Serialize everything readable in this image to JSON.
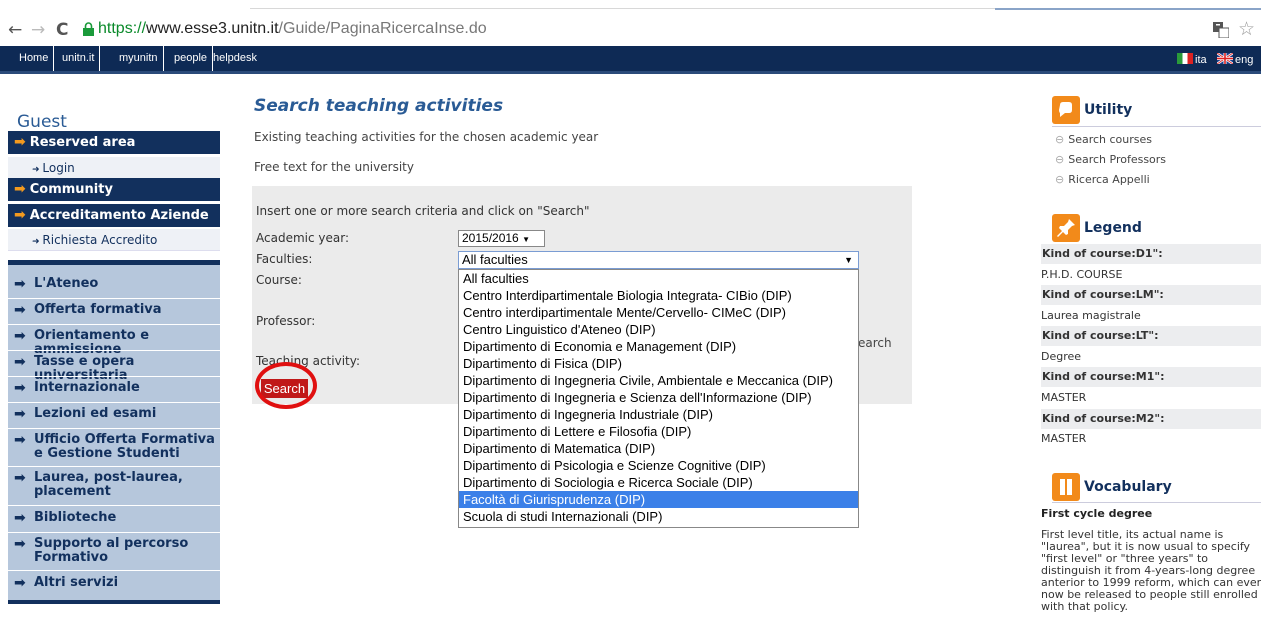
{
  "browser": {
    "url_protocol": "https://",
    "url_host": "www.esse3.unitn.it",
    "url_path": "/Guide/PaginaRicercaInse.do",
    "back": "←",
    "forward": "→",
    "reload": "C",
    "star": "☆"
  },
  "topnav": {
    "items": [
      "Home",
      "unitn.it",
      "myunitn",
      "people",
      "helpdesk"
    ],
    "lang_ita": "ita",
    "lang_eng": "eng"
  },
  "sidebar": {
    "guest": "Guest",
    "reserved_area": "Reserved area",
    "login": "Login",
    "community": "Community",
    "accreditamento": "Accreditamento Aziende",
    "richiesta": "Richiesta Accredito",
    "menu": [
      "L'Ateneo",
      "Offerta formativa",
      "Orientamento e ammissione",
      "Tasse e opera universitaria",
      "Internazionale",
      "Lezioni ed esami",
      "Ufficio Offerta Formativa e Gestione Studenti",
      "Laurea, post-laurea, placement",
      "Biblioteche",
      "Supporto al percorso Formativo",
      "Altri servizi"
    ]
  },
  "main": {
    "title": "Search teaching activities",
    "subtitle": "Existing teaching activities for the chosen academic year",
    "free_text": "Free text for the university",
    "instructions": "Insert one or more search criteria and click on \"Search\"",
    "label_year": "Academic year:",
    "label_faculties": "Faculties:",
    "label_course": "Course:",
    "label_professor": "Professor:",
    "label_teaching": "Teaching activity:",
    "year_value": "2015/2016",
    "faculty_value": "All faculties",
    "partial_text": "earch",
    "search_button": "Search",
    "options": [
      "All faculties",
      "Centro Interdipartimentale Biologia Integrata- CIBio (DIP)",
      "Centro interdipartimentale Mente/Cervello- CIMeC  (DIP)",
      "Centro Linguistico d'Ateneo (DIP)",
      "Dipartimento di Economia e Management (DIP)",
      "Dipartimento di Fisica (DIP)",
      "Dipartimento di Ingegneria Civile, Ambientale e Meccanica (DIP)",
      "Dipartimento di Ingegneria e Scienza dell'Informazione (DIP)",
      "Dipartimento di Ingegneria Industriale (DIP)",
      "Dipartimento di Lettere e Filosofia (DIP)",
      "Dipartimento di Matematica (DIP)",
      "Dipartimento di Psicologia e Scienze Cognitive (DIP)",
      "Dipartimento di Sociologia e Ricerca Sociale (DIP)",
      "Facoltà di Giurisprudenza (DIP)",
      "Scuola di studi Internazionali (DIP)"
    ],
    "highlighted_option_index": 13
  },
  "right": {
    "utility_title": "Utility",
    "utility_links": [
      "Search courses",
      "Search Professors",
      "Ricerca Appelli"
    ],
    "legend_title": "Legend",
    "legend": [
      {
        "k": "Kind of course:D1\":",
        "v": "P.H.D. COURSE"
      },
      {
        "k": "Kind of course:LM\":",
        "v": "Laurea magistrale"
      },
      {
        "k": "Kind of course:LT\":",
        "v": "Degree"
      },
      {
        "k": "Kind of course:M1\":",
        "v": "MASTER"
      },
      {
        "k": "Kind of course:M2\":",
        "v": "MASTER"
      }
    ],
    "vocabulary_title": "Vocabulary",
    "vocab_term": "First cycle degree",
    "vocab_def": "First level title, its actual name is \"laurea\", but it is now usual to specify \"first level\" or \"three years\" to distinguish it from 4-years-long degree anterior to 1999 reform, which can even now be released to people still enrolled with that policy."
  },
  "colors": {
    "navy": "#12305d",
    "accent_orange": "#f28a1a",
    "title_blue": "#2a5b95",
    "highlight": "#3b80e8",
    "search_red": "#c01818"
  }
}
